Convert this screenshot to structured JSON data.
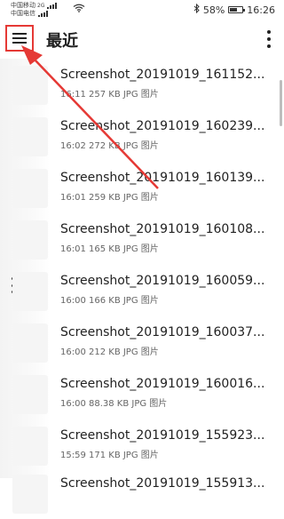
{
  "status": {
    "carrier1": "中国移动",
    "carrier1_net": "2G",
    "carrier2": "中国电信",
    "battery": "58%",
    "battery_level": 0.58,
    "time": "16:26"
  },
  "header": {
    "title": "最近"
  },
  "files": [
    {
      "name": "Screenshot_20191019_161152...",
      "meta": "16:11 257 KB JPG 图片"
    },
    {
      "name": "Screenshot_20191019_160239...",
      "meta": "16:02 272 KB JPG 图片"
    },
    {
      "name": "Screenshot_20191019_160139...",
      "meta": "16:01 259 KB JPG 图片"
    },
    {
      "name": "Screenshot_20191019_160108...",
      "meta": "16:01 165 KB JPG 图片"
    },
    {
      "name": "Screenshot_20191019_160059...",
      "meta": "16:00 166 KB JPG 图片"
    },
    {
      "name": "Screenshot_20191019_160037...",
      "meta": "16:00 212 KB JPG 图片"
    },
    {
      "name": "Screenshot_20191019_160016...",
      "meta": "16:00 88.38 KB JPG 图片"
    },
    {
      "name": "Screenshot_20191019_155923...",
      "meta": "15:59 171 KB JPG 图片"
    },
    {
      "name": "Screenshot_20191019_155913...",
      "meta": ""
    }
  ],
  "annotation": {
    "color": "#e53935"
  },
  "icons": {
    "menu": "hamburger-menu-icon",
    "more": "overflow-menu-icon",
    "wifi": "wifi-icon",
    "bluetooth": "bluetooth-icon",
    "battery": "battery-icon"
  }
}
